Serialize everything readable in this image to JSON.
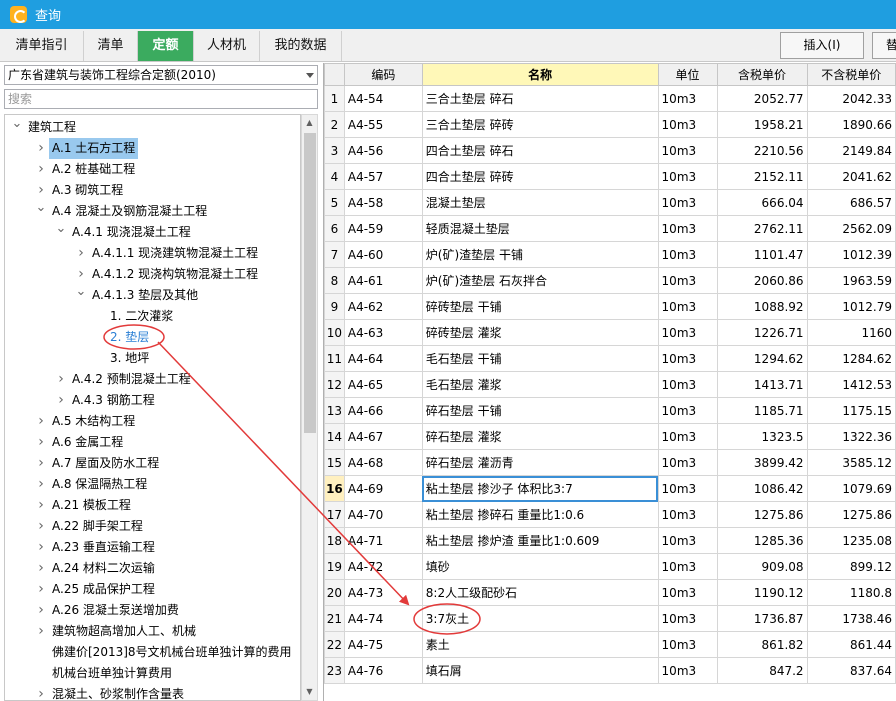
{
  "window": {
    "title": "查询"
  },
  "tabs": [
    {
      "label": "清单指引",
      "active": false
    },
    {
      "label": "清单",
      "active": false
    },
    {
      "label": "定额",
      "active": true
    },
    {
      "label": "人材机",
      "active": false
    },
    {
      "label": "我的数据",
      "active": false
    }
  ],
  "toolbar": {
    "insert_label": "插入(I)",
    "next_label": "替"
  },
  "left": {
    "library": "广东省建筑与装饰工程综合定额(2010)",
    "search_placeholder": "搜索",
    "tree": [
      {
        "label": "建筑工程",
        "level": 0,
        "state": "open"
      },
      {
        "label": "A.1 土石方工程",
        "level": 1,
        "state": "closed",
        "selected": true
      },
      {
        "label": "A.2 桩基础工程",
        "level": 1,
        "state": "closed"
      },
      {
        "label": "A.3 砌筑工程",
        "level": 1,
        "state": "closed"
      },
      {
        "label": "A.4 混凝土及钢筋混凝土工程",
        "level": 1,
        "state": "open"
      },
      {
        "label": "A.4.1 现浇混凝土工程",
        "level": 2,
        "state": "open"
      },
      {
        "label": "A.4.1.1 现浇建筑物混凝土工程",
        "level": 3,
        "state": "closed"
      },
      {
        "label": "A.4.1.2 现浇构筑物混凝土工程",
        "level": 3,
        "state": "closed"
      },
      {
        "label": "A.4.1.3 垫层及其他",
        "level": 3,
        "state": "open"
      },
      {
        "label": "1. 二次灌浆",
        "level": 4,
        "state": "leaf"
      },
      {
        "label": "2. 垫层",
        "level": 4,
        "state": "leaf",
        "highlight": true
      },
      {
        "label": "3. 地坪",
        "level": 4,
        "state": "leaf"
      },
      {
        "label": "A.4.2 预制混凝土工程",
        "level": 2,
        "state": "closed"
      },
      {
        "label": "A.4.3 钢筋工程",
        "level": 2,
        "state": "closed"
      },
      {
        "label": "A.5 木结构工程",
        "level": 1,
        "state": "closed"
      },
      {
        "label": "A.6 金属工程",
        "level": 1,
        "state": "closed"
      },
      {
        "label": "A.7 屋面及防水工程",
        "level": 1,
        "state": "closed"
      },
      {
        "label": "A.8 保温隔热工程",
        "level": 1,
        "state": "closed"
      },
      {
        "label": "A.21 模板工程",
        "level": 1,
        "state": "closed"
      },
      {
        "label": "A.22 脚手架工程",
        "level": 1,
        "state": "closed"
      },
      {
        "label": "A.23 垂直运输工程",
        "level": 1,
        "state": "closed"
      },
      {
        "label": "A.24 材料二次运输",
        "level": 1,
        "state": "closed"
      },
      {
        "label": "A.25 成品保护工程",
        "level": 1,
        "state": "closed"
      },
      {
        "label": "A.26 混凝土泵送增加费",
        "level": 1,
        "state": "closed"
      },
      {
        "label": "建筑物超高增加人工、机械",
        "level": 1,
        "state": "closed"
      },
      {
        "label": "佛建价[2013]8号文机械台班单独计算的费用",
        "level": 1,
        "state": "none"
      },
      {
        "label": "机械台班单独计算费用",
        "level": 1,
        "state": "none"
      },
      {
        "label": "混凝土、砂浆制作含量表",
        "level": 1,
        "state": "closed"
      }
    ]
  },
  "grid": {
    "columns": [
      "编码",
      "名称",
      "单位",
      "含税单价",
      "不含税单价"
    ],
    "current_row": "16",
    "rows": [
      [
        "1",
        "A4-54",
        "三合土垫层 碎石",
        "10m3",
        "2052.77",
        "2042.33"
      ],
      [
        "2",
        "A4-55",
        "三合土垫层 碎砖",
        "10m3",
        "1958.21",
        "1890.66"
      ],
      [
        "3",
        "A4-56",
        "四合土垫层 碎石",
        "10m3",
        "2210.56",
        "2149.84"
      ],
      [
        "4",
        "A4-57",
        "四合土垫层 碎砖",
        "10m3",
        "2152.11",
        "2041.62"
      ],
      [
        "5",
        "A4-58",
        "混凝土垫层",
        "10m3",
        "666.04",
        "686.57"
      ],
      [
        "6",
        "A4-59",
        "轻质混凝土垫层",
        "10m3",
        "2762.11",
        "2562.09"
      ],
      [
        "7",
        "A4-60",
        "炉(矿)渣垫层 干铺",
        "10m3",
        "1101.47",
        "1012.39"
      ],
      [
        "8",
        "A4-61",
        "炉(矿)渣垫层 石灰拌合",
        "10m3",
        "2060.86",
        "1963.59"
      ],
      [
        "9",
        "A4-62",
        "碎砖垫层 干铺",
        "10m3",
        "1088.92",
        "1012.79"
      ],
      [
        "10",
        "A4-63",
        "碎砖垫层 灌浆",
        "10m3",
        "1226.71",
        "1160"
      ],
      [
        "11",
        "A4-64",
        "毛石垫层 干铺",
        "10m3",
        "1294.62",
        "1284.62"
      ],
      [
        "12",
        "A4-65",
        "毛石垫层 灌浆",
        "10m3",
        "1413.71",
        "1412.53"
      ],
      [
        "13",
        "A4-66",
        "碎石垫层 干铺",
        "10m3",
        "1185.71",
        "1175.15"
      ],
      [
        "14",
        "A4-67",
        "碎石垫层 灌浆",
        "10m3",
        "1323.5",
        "1322.36"
      ],
      [
        "15",
        "A4-68",
        "碎石垫层 灌沥青",
        "10m3",
        "3899.42",
        "3585.12"
      ],
      [
        "16",
        "A4-69",
        "粘土垫层 掺沙子 体积比3:7",
        "10m3",
        "1086.42",
        "1079.69"
      ],
      [
        "17",
        "A4-70",
        "粘土垫层 掺碎石 重量比1:0.6",
        "10m3",
        "1275.86",
        "1275.86"
      ],
      [
        "18",
        "A4-71",
        "粘土垫层 掺炉渣 重量比1:0.609",
        "10m3",
        "1285.36",
        "1235.08"
      ],
      [
        "19",
        "A4-72",
        "填砂",
        "10m3",
        "909.08",
        "899.12"
      ],
      [
        "20",
        "A4-73",
        "8:2人工级配砂石",
        "10m3",
        "1190.12",
        "1180.8"
      ],
      [
        "21",
        "A4-74",
        "3:7灰土",
        "10m3",
        "1736.87",
        "1738.46"
      ],
      [
        "22",
        "A4-75",
        "素土",
        "10m3",
        "861.82",
        "861.44"
      ],
      [
        "23",
        "A4-76",
        "填石屑",
        "10m3",
        "847.2",
        "837.64"
      ]
    ]
  },
  "colors": {
    "titlebar": "#1f9ee0",
    "active_tab": "#3bab5f",
    "annotation": "#e23a3a",
    "selection": "#99c9ee"
  },
  "annotations": {
    "tree_circle_target": "2. 垫层",
    "grid_circle_target": "3:7灰土"
  }
}
